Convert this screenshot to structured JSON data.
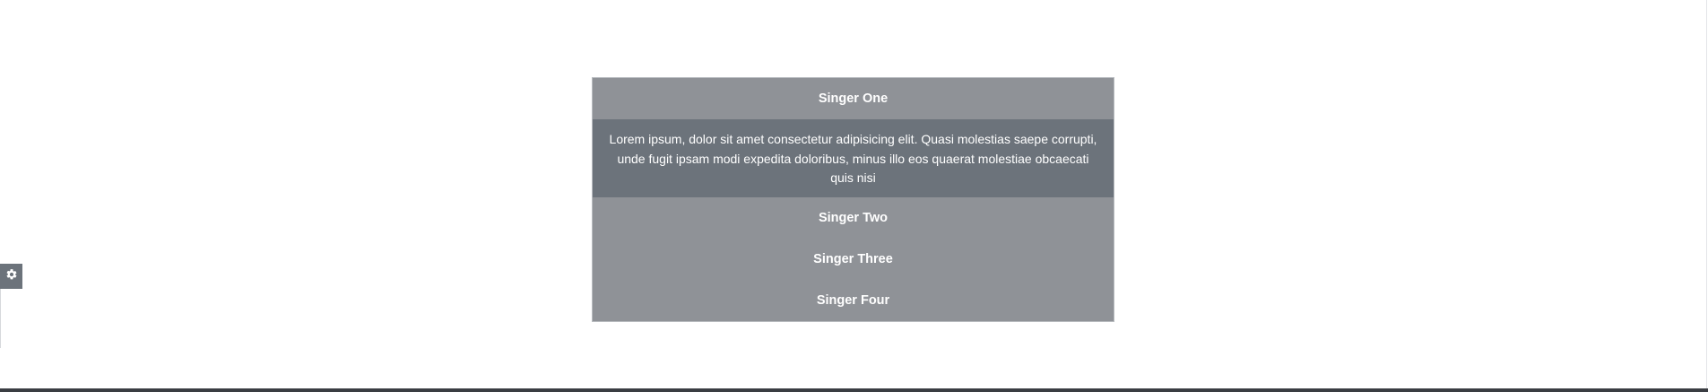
{
  "accordion": {
    "items": [
      {
        "title": "Singer One",
        "expanded": true,
        "body": "Lorem ipsum, dolor sit amet consectetur adipisicing elit. Quasi molestias saepe corrupti, unde fugit ipsam modi expedita doloribus, minus illo eos quaerat molestiae obcaecati quis nisi"
      },
      {
        "title": "Singer Two",
        "expanded": false
      },
      {
        "title": "Singer Three",
        "expanded": false
      },
      {
        "title": "Singer Four",
        "expanded": false
      }
    ]
  },
  "settings": {
    "icon": "gear-icon"
  },
  "colors": {
    "header_bg": "#8f9297",
    "panel_bg": "#6c737b",
    "text": "#ffffff"
  }
}
